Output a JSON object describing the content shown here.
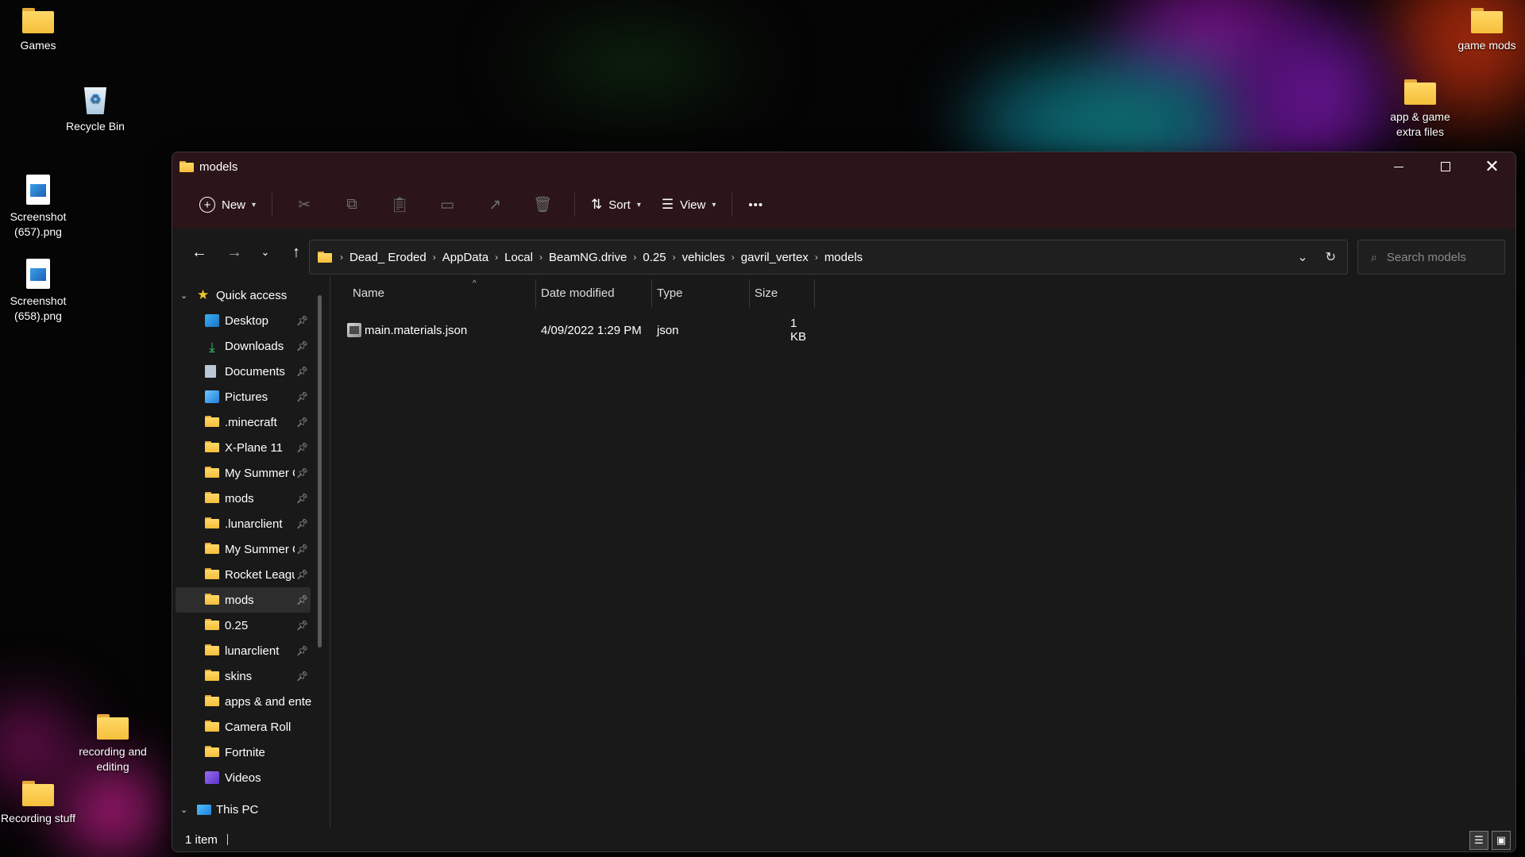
{
  "desktop": {
    "icons": {
      "games": "Games",
      "recycle_bin": "Recycle Bin",
      "screenshot_657": "Screenshot (657).png",
      "screenshot_658": "Screenshot (658).png",
      "recording_and_editing": "recording and editing",
      "recording_stuff": "Recording stuff",
      "game_mods": "game mods",
      "app_game_extra": "app & game extra files"
    }
  },
  "window": {
    "title": "models",
    "controls": {
      "minimize": "minimize",
      "maximize": "maximize",
      "close": "close"
    }
  },
  "toolbar": {
    "new_label": "New",
    "sort_label": "Sort",
    "view_label": "View",
    "more_label": "•••"
  },
  "address": {
    "crumbs": [
      "Dead_ Eroded",
      "AppData",
      "Local",
      "BeamNG.drive",
      "0.25",
      "vehicles",
      "gavril_vertex",
      "models"
    ],
    "search_placeholder": "Search models"
  },
  "navpane": {
    "quick_access": "Quick access",
    "items": [
      {
        "label": "Desktop",
        "icon": "desktop-icon"
      },
      {
        "label": "Downloads",
        "icon": "download-icon"
      },
      {
        "label": "Documents",
        "icon": "document-icon"
      },
      {
        "label": "Pictures",
        "icon": "pictures-icon"
      },
      {
        "label": ".minecraft",
        "icon": "folder-icon"
      },
      {
        "label": "X-Plane 11",
        "icon": "folder-icon"
      },
      {
        "label": "My Summer C",
        "icon": "folder-icon"
      },
      {
        "label": "mods",
        "icon": "folder-icon"
      },
      {
        "label": ".lunarclient",
        "icon": "folder-icon"
      },
      {
        "label": "My Summer C",
        "icon": "folder-icon"
      },
      {
        "label": "Rocket Leagu",
        "icon": "folder-icon"
      },
      {
        "label": "mods",
        "icon": "folder-icon"
      },
      {
        "label": "0.25",
        "icon": "folder-icon"
      },
      {
        "label": "lunarclient",
        "icon": "folder-icon"
      },
      {
        "label": "skins",
        "icon": "folder-icon"
      },
      {
        "label": "apps & and ente",
        "icon": "folder-icon"
      },
      {
        "label": "Camera Roll",
        "icon": "folder-icon"
      },
      {
        "label": "Fortnite",
        "icon": "folder-icon"
      },
      {
        "label": "Videos",
        "icon": "videos-icon"
      }
    ],
    "this_pc": "This PC"
  },
  "columns": {
    "name": "Name",
    "date": "Date modified",
    "type": "Type",
    "size": "Size"
  },
  "files": [
    {
      "name": "main.materials.json",
      "date": "4/09/2022 1:29 PM",
      "type": "json",
      "size": "1 KB"
    }
  ],
  "status": {
    "count": "1 item"
  },
  "colors": {
    "titlebar": "#2b1518",
    "window_bg": "#191919",
    "folder": "#f6bf3b"
  }
}
